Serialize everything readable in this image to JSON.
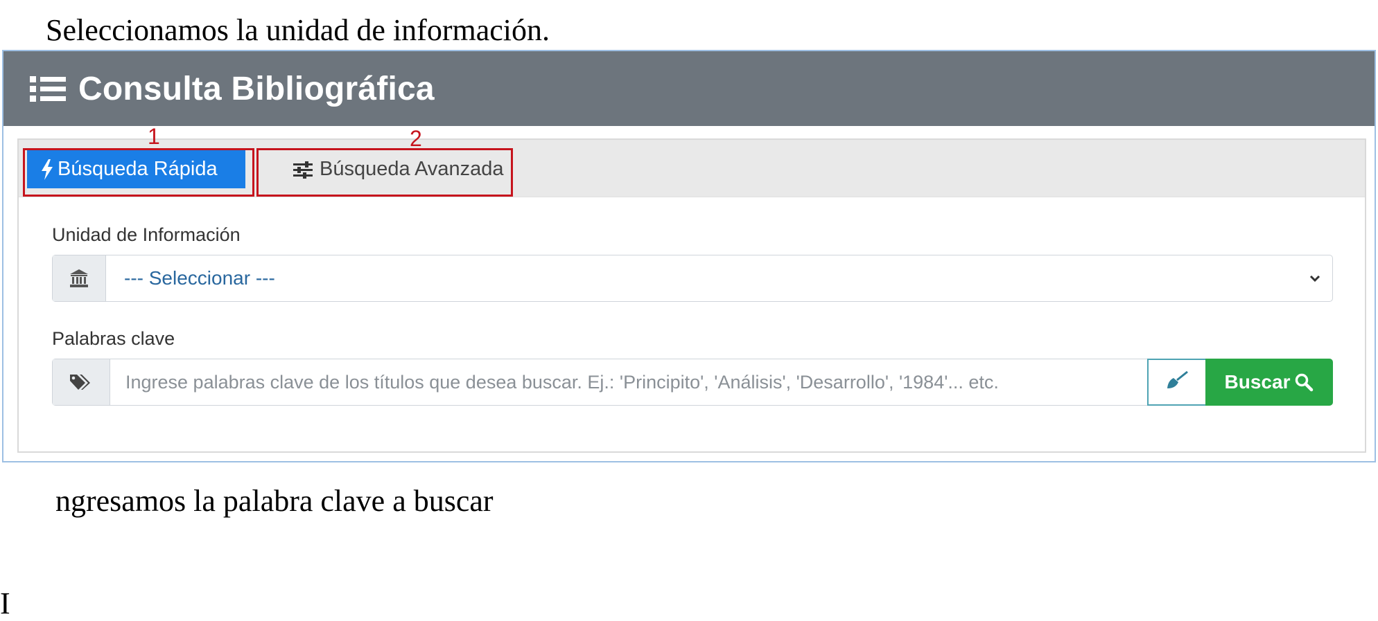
{
  "document": {
    "intro_text": "Seleccionamos la unidad de información.",
    "after_text": "ngresamos la palabra clave a buscar",
    "stray_text": "I"
  },
  "card": {
    "title": "Consulta Bibliográfica",
    "header_icon": "list-icon",
    "header_color": "#6d757d"
  },
  "tabs": {
    "quick_label": "Búsqueda Rápida",
    "quick_icon": "bolt-icon",
    "advanced_label": "Búsqueda Avanzada",
    "advanced_icon": "sliders-icon",
    "active_color": "#1a7ee6"
  },
  "annotations": {
    "first": "1",
    "second": "2",
    "color": "#c6141d"
  },
  "form": {
    "unit_label": "Unidad de Información",
    "unit_icon": "institution-icon",
    "unit_selected": "--- Seleccionar ---",
    "keywords_label": "Palabras clave",
    "keywords_icon": "tags-icon",
    "keywords_placeholder": "Ingrese palabras clave de los títulos que desea buscar. Ej.: 'Principito', 'Análisis', 'Desarrollo', '1984'... etc.",
    "keywords_value": "",
    "clear_icon": "broom-icon",
    "search_label": "Buscar",
    "search_icon": "search-icon",
    "search_color": "#28a745"
  }
}
